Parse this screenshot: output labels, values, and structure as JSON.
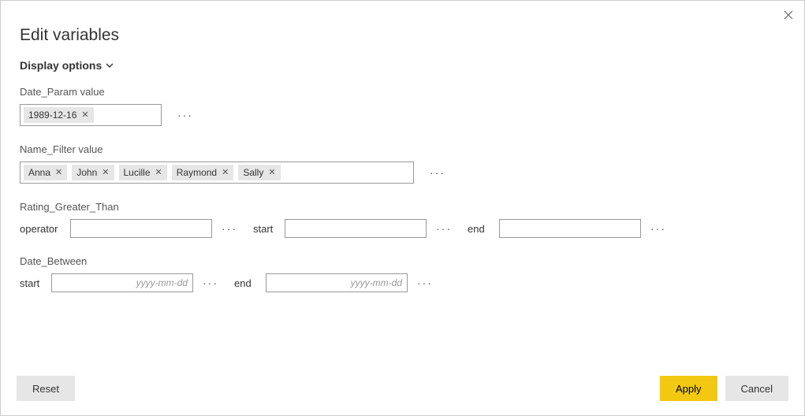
{
  "header": {
    "title": "Edit variables"
  },
  "display_options": {
    "label": "Display options"
  },
  "date_param": {
    "label": "Date_Param value",
    "value": "1989-12-16"
  },
  "name_filter": {
    "label": "Name_Filter value",
    "tags": [
      "Anna",
      "John",
      "Lucille",
      "Raymond",
      "Sally"
    ]
  },
  "rating_greater_than": {
    "label": "Rating_Greater_Than",
    "operator": {
      "label": "operator",
      "value": ""
    },
    "start": {
      "label": "start",
      "value": ""
    },
    "end": {
      "label": "end",
      "value": ""
    }
  },
  "date_between": {
    "label": "Date_Between",
    "start": {
      "label": "start",
      "value": "",
      "placeholder": "yyyy-mm-dd"
    },
    "end": {
      "label": "end",
      "value": "",
      "placeholder": "yyyy-mm-dd"
    }
  },
  "footer": {
    "reset": "Reset",
    "apply": "Apply",
    "cancel": "Cancel"
  },
  "glyphs": {
    "ellipsis": "···"
  }
}
